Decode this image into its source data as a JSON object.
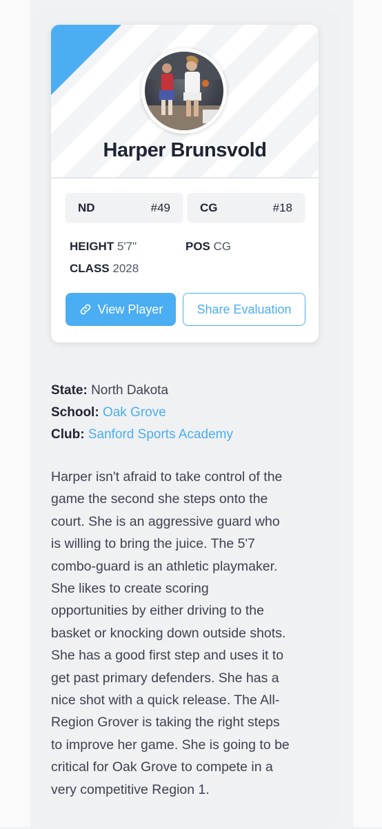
{
  "player": {
    "name": "Harper Brunsvold",
    "ranks": [
      {
        "label": "ND",
        "value": "#49"
      },
      {
        "label": "CG",
        "value": "#18"
      }
    ],
    "height_label": "HEIGHT",
    "height": "5'7\"",
    "pos_label": "POS",
    "pos": "CG",
    "class_label": "CLASS",
    "class": "2028"
  },
  "buttons": {
    "view_player": "View Player",
    "share_evaluation": "Share Evaluation"
  },
  "details": {
    "state_label": "State:",
    "state": "North Dakota",
    "school_label": "School:",
    "school": "Oak Grove",
    "club_label": "Club:",
    "club": "Sanford Sports Academy"
  },
  "bio_lines": [
    "Harper isn't afraid to take control of the",
    "game the second she steps onto the",
    "court. She is an aggressive guard who",
    "is willing to bring the juice. The 5'7",
    "combo-guard is an athletic playmaker.",
    "She likes to create scoring",
    "opportunities by either driving to the",
    "basket or knocking down outside shots.",
    "She has a good first step and uses it to",
    "get past primary defenders. She has a",
    "nice shot with a quick release. The All-",
    "Region Grover is taking the right steps",
    "to improve her game. She is going to be",
    "critical for Oak Grove to compete in a",
    "very competitive Region 1."
  ],
  "icons": {
    "view_player": "link-icon",
    "avatar": "player-photo"
  },
  "colors": {
    "accent": "#4badf2",
    "text_dark": "#1e2433"
  }
}
